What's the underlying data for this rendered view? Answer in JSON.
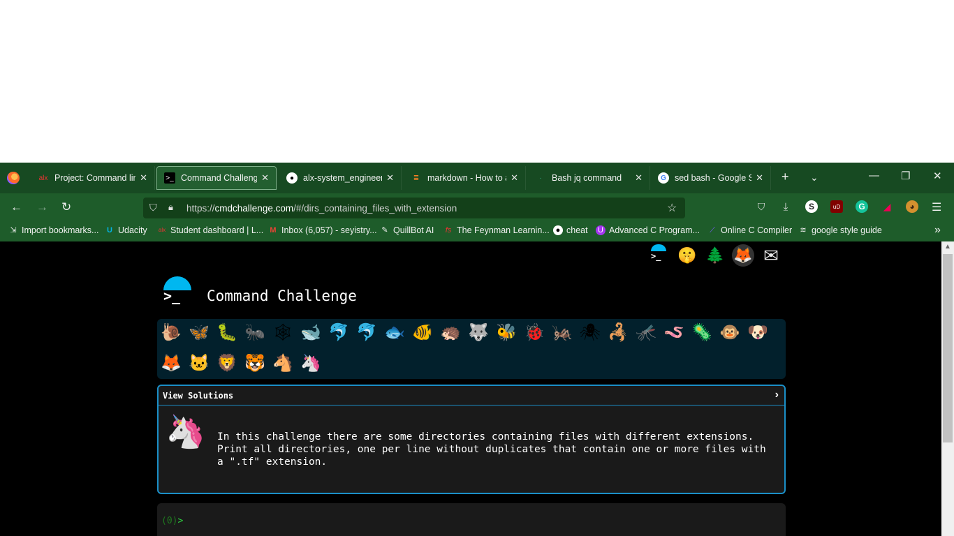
{
  "browser": {
    "tabs": [
      {
        "title": "Project: Command line",
        "icon": "alx-favicon",
        "active": false
      },
      {
        "title": "Command Challenge!",
        "icon": "terminal-favicon",
        "active": true
      },
      {
        "title": "alx-system_engineering",
        "icon": "github-favicon",
        "active": false
      },
      {
        "title": "markdown - How to add",
        "icon": "stackoverflow-favicon",
        "active": false
      },
      {
        "title": "Bash jq command",
        "icon": "page-favicon",
        "active": false
      },
      {
        "title": "sed bash - Google Search",
        "icon": "google-favicon",
        "active": false
      }
    ],
    "url": {
      "scheme": "https://",
      "host": "cmdchallenge.com",
      "path": "/#/dirs_containing_files_with_extension"
    },
    "bookmarks": [
      {
        "label": "Import bookmarks...",
        "icon": "import-icon"
      },
      {
        "label": "Udacity",
        "icon": "udacity-icon"
      },
      {
        "label": "Student dashboard | L...",
        "icon": "alx-icon"
      },
      {
        "label": "Inbox (6,057) - seyistry...",
        "icon": "gmail-icon"
      },
      {
        "label": "QuillBot AI",
        "icon": "quillbot-icon"
      },
      {
        "label": "The Feynman Learnin...",
        "icon": "fs-icon"
      },
      {
        "label": "cheat",
        "icon": "github-icon"
      },
      {
        "label": "Advanced C Program...",
        "icon": "udemy-icon"
      },
      {
        "label": "Online C Compiler",
        "icon": "compiler-icon"
      },
      {
        "label": "google style guide",
        "icon": "guide-icon"
      }
    ]
  },
  "page": {
    "title": "Command Challenge",
    "logo_prompt": ">_",
    "view_solutions_label": "View Solutions",
    "description": "In this challenge there are some directories containing files with different extensions. Print all directories, one per line without duplicates that contain one or more files with a \".tf\" extension.",
    "prompt_code": "(0)",
    "prompt_arrow": ">",
    "animals": [
      "🐌",
      "🦋",
      "🐛",
      "🐜",
      "🕸",
      "🐋",
      "🐬",
      "🐬",
      "🐟",
      "🐠",
      "🦔",
      "🐺",
      "🐝",
      "🐞",
      "🦗",
      "🕷",
      "🦂",
      "🦟",
      "🪱",
      "🦠",
      "🐵",
      "🐶",
      "🦊",
      "🐱",
      "🦁",
      "🐯",
      "🐴",
      "🦄"
    ],
    "current_animal": "🦄"
  }
}
